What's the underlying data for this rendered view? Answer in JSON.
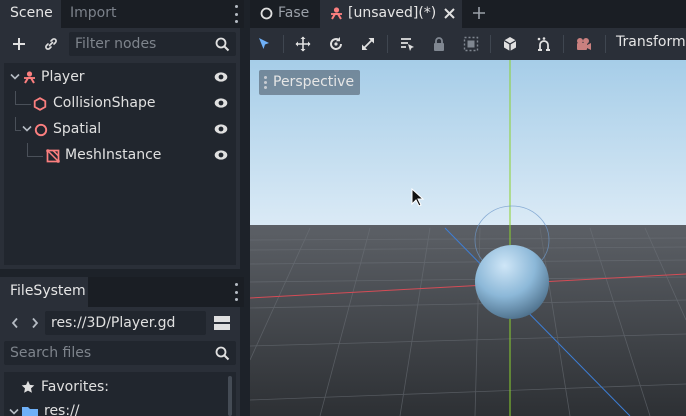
{
  "scene_dock": {
    "tabs": [
      "Scene",
      "Import"
    ],
    "filter_placeholder": "Filter nodes",
    "nodes": [
      {
        "name": "Player",
        "icon": "kinematic-body-icon",
        "color": "#fc7f7f"
      },
      {
        "name": "CollisionShape",
        "icon": "collision-shape-icon",
        "color": "#fc7f7f"
      },
      {
        "name": "Spatial",
        "icon": "spatial-icon",
        "color": "#fc7f7f"
      },
      {
        "name": "MeshInstance",
        "icon": "mesh-instance-icon",
        "color": "#fc7f7f"
      }
    ]
  },
  "filesystem_dock": {
    "tab": "FileSystem",
    "path": "res://3D/Player.gd",
    "search_placeholder": "Search files",
    "favorites_label": "Favorites:",
    "root_label": "res://"
  },
  "editor_tabs": [
    {
      "label": "Fase",
      "active": false
    },
    {
      "label": "[unsaved](*)",
      "active": true
    }
  ],
  "toolbar": {
    "transform_label": "Transform"
  },
  "viewport": {
    "mode_label": "Perspective"
  },
  "colors": {
    "accent": "#6fb0f7",
    "node_red": "#fc7f7f",
    "panel": "#2a2f38",
    "background": "#1d2229"
  }
}
